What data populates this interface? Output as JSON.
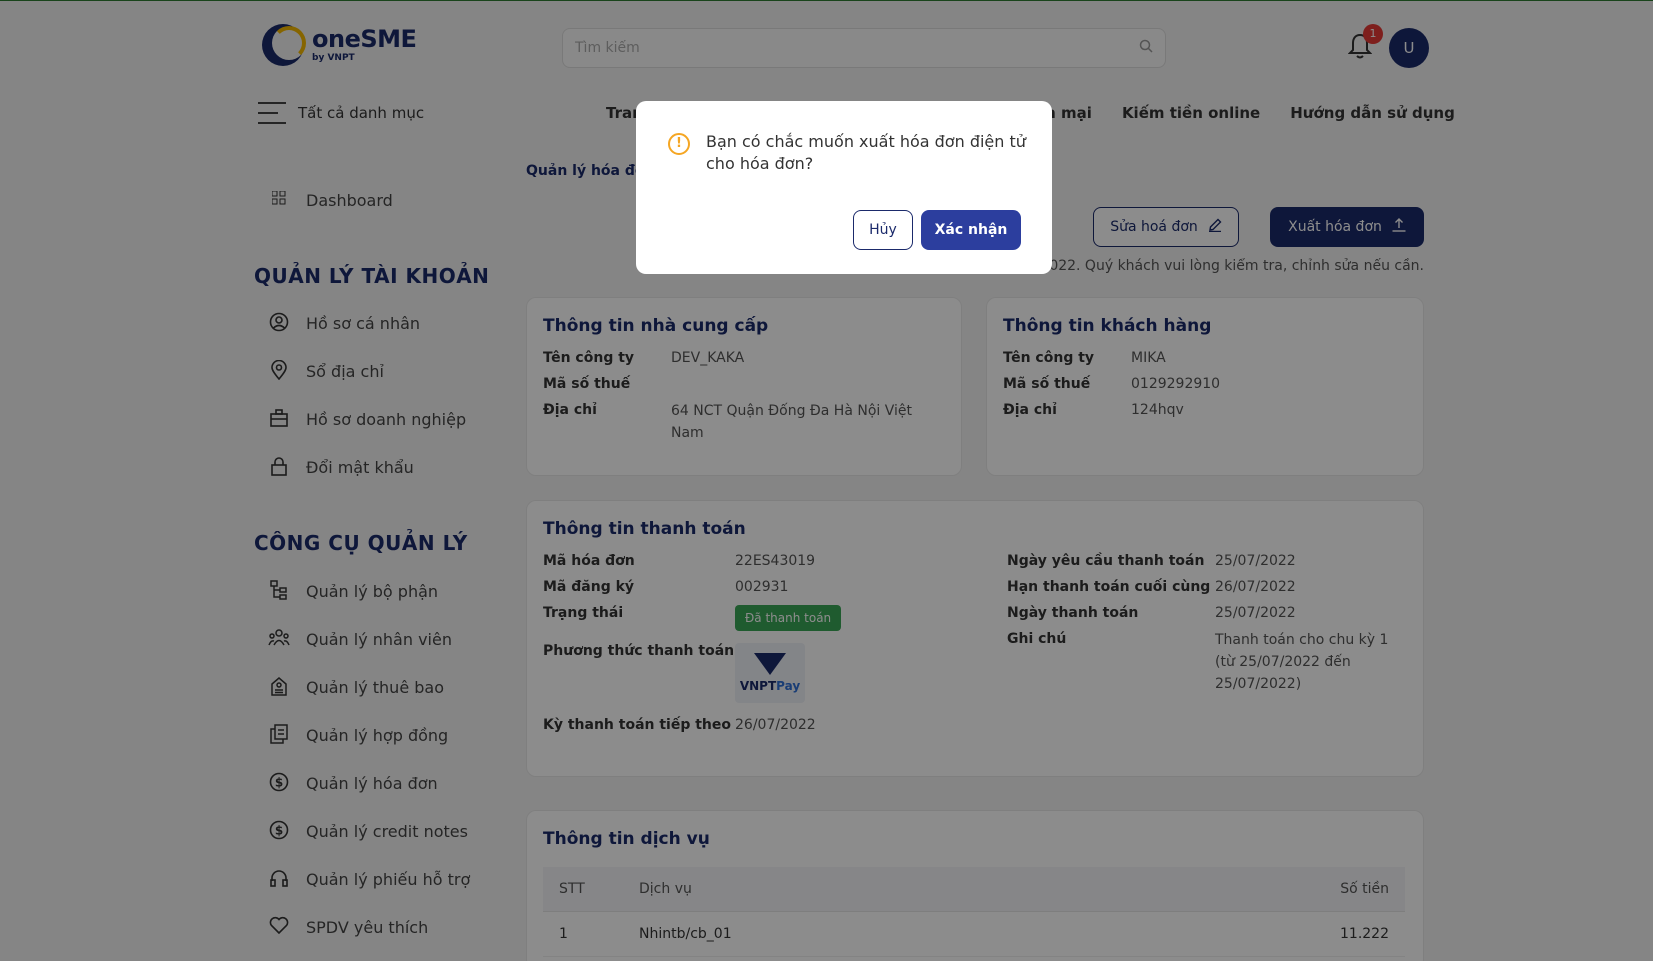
{
  "header": {
    "logo_main": "oneSME",
    "logo_sub": "by VNPT",
    "search_placeholder": "Tìm kiếm",
    "notification_count": "1",
    "avatar_initial": "U",
    "menu_label": "Tất cả danh mục",
    "nav": [
      "Tran",
      "in mại",
      "Kiếm tiền online",
      "Hướng dẫn sử dụng"
    ]
  },
  "sidebar": {
    "dashboard": "Dashboard",
    "section_account": "QUẢN LÝ TÀI KHOẢN",
    "account_items": [
      {
        "label": "Hồ sơ cá nhân",
        "icon": "user-circle-icon"
      },
      {
        "label": "Sổ địa chỉ",
        "icon": "map-pin-icon"
      },
      {
        "label": "Hồ sơ doanh nghiệp",
        "icon": "briefcase-icon"
      },
      {
        "label": "Đổi mật khẩu",
        "icon": "lock-icon"
      }
    ],
    "section_tools": "CÔNG CỤ QUẢN LÝ",
    "tool_items": [
      {
        "label": "Quản lý bộ phận",
        "icon": "org-tree-icon"
      },
      {
        "label": "Quản lý nhân viên",
        "icon": "users-icon"
      },
      {
        "label": "Quản lý thuê bao",
        "icon": "subscription-icon"
      },
      {
        "label": "Quản lý hợp đồng",
        "icon": "documents-icon"
      },
      {
        "label": "Quản lý hóa đơn",
        "icon": "dollar-circle-icon"
      },
      {
        "label": "Quản lý credit notes",
        "icon": "dollar-circle-icon"
      },
      {
        "label": "Quản lý phiếu hỗ trợ",
        "icon": "headset-icon"
      },
      {
        "label": "SPDV yêu thích",
        "icon": "heart-icon"
      }
    ]
  },
  "main": {
    "breadcrumb": "Quản lý hóa đơ",
    "edit_button": "Sửa hoá đơn",
    "export_button": "Xuất hóa đơn",
    "notice": "022. Quý khách vui lòng kiểm tra, chỉnh sửa nếu cần.",
    "supplier": {
      "title": "Thông tin nhà cung cấp",
      "company_label": "Tên công ty",
      "company": "DEV_KAKA",
      "tax_label": "Mã số thuế",
      "tax": "",
      "address_label": "Địa chỉ",
      "address": "64 NCT Quận Đống Đa Hà Nội Việt Nam"
    },
    "customer": {
      "title": "Thông tin khách hàng",
      "company_label": "Tên công ty",
      "company": "MIKA",
      "tax_label": "Mã số thuế",
      "tax": "0129292910",
      "address_label": "Địa chỉ",
      "address": "124hqv"
    },
    "payment": {
      "title": "Thông tin thanh toán",
      "invoice_label": "Mã hóa đơn",
      "invoice": "22ES43019",
      "reg_label": "Mã đăng ký",
      "reg": "002931",
      "status_label": "Trạng thái",
      "status": "Đã thanh toán",
      "method_label": "Phương thức thanh toán",
      "method_logo_a": "VNPT",
      "method_logo_b": "Pay",
      "next_label": "Kỳ thanh toán tiếp theo",
      "next": "26/07/2022",
      "req_date_label": "Ngày yêu cầu thanh toán",
      "req_date": "25/07/2022",
      "due_label": "Hạn thanh toán cuối cùng",
      "due": "26/07/2022",
      "paid_label": "Ngày thanh toán",
      "paid": "25/07/2022",
      "note_label": "Ghi chú",
      "note": "Thanh toán cho chu kỳ 1 (từ 25/07/2022 đến 25/07/2022)"
    },
    "service": {
      "title": "Thông tin dịch vụ",
      "col_stt": "STT",
      "col_service": "Dịch vụ",
      "col_amount": "Số tiền",
      "rows": [
        {
          "stt": "1",
          "service": "Nhintb/cb_01",
          "amount": "11.222"
        }
      ]
    }
  },
  "modal": {
    "message": "Bạn có chắc muốn xuất hóa đơn điện tử cho hóa đơn?",
    "cancel": "Hủy",
    "confirm": "Xác nhận"
  },
  "colors": {
    "brand": "#1b2a6b",
    "accent": "#f5b800",
    "success": "#3aa657",
    "warning": "#f5a623"
  }
}
